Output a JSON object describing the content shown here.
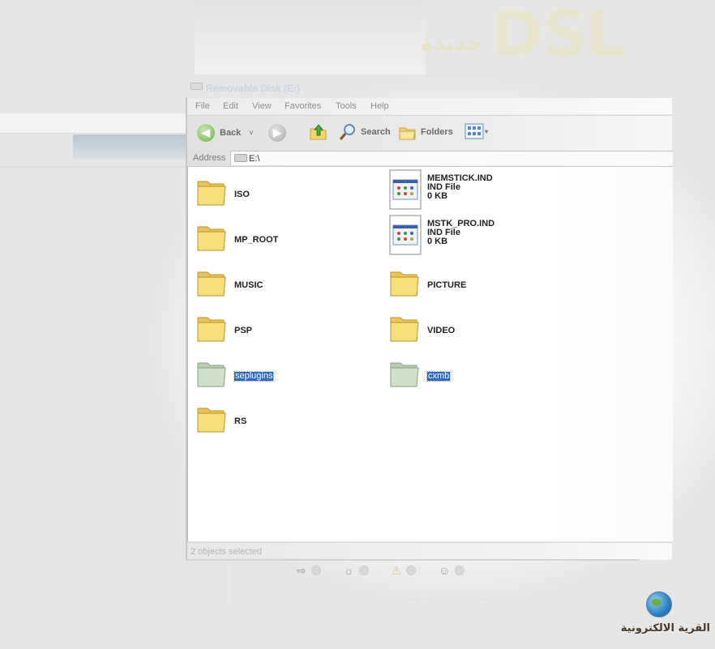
{
  "background": {
    "banner_latin": "DSL",
    "banner_arabic": "جديدة",
    "logo_text": "القرية الالكترونية"
  },
  "window": {
    "title": "Removable Disk (E:)",
    "menu": [
      "File",
      "Edit",
      "View",
      "Favorites",
      "Tools",
      "Help"
    ],
    "toolbar": {
      "back_label": "Back",
      "search_label": "Search",
      "folders_label": "Folders"
    },
    "address": {
      "label": "Address",
      "value": "E:\\"
    },
    "status": "2 objects selected"
  },
  "items": [
    {
      "name": "ISO",
      "kind": "folder"
    },
    {
      "name": "MEMSTICK.IND",
      "kind": "file",
      "type": "IND File",
      "size": "0 KB"
    },
    {
      "name": "MP_ROOT",
      "kind": "folder"
    },
    {
      "name": "MSTK_PRO.IND",
      "kind": "file",
      "type": "IND File",
      "size": "0 KB"
    },
    {
      "name": "MUSIC",
      "kind": "folder"
    },
    {
      "name": "PICTURE",
      "kind": "folder"
    },
    {
      "name": "PSP",
      "kind": "folder"
    },
    {
      "name": "VIDEO",
      "kind": "folder"
    },
    {
      "name": "seplugins",
      "kind": "folder",
      "selected": true
    },
    {
      "name": "cxmb",
      "kind": "folder",
      "selected": true
    },
    {
      "name": "RS",
      "kind": "folder"
    }
  ],
  "colors": {
    "selection": "#316ac5",
    "folder": "#f7df7a",
    "folder_selected": "#cfe0c8"
  }
}
